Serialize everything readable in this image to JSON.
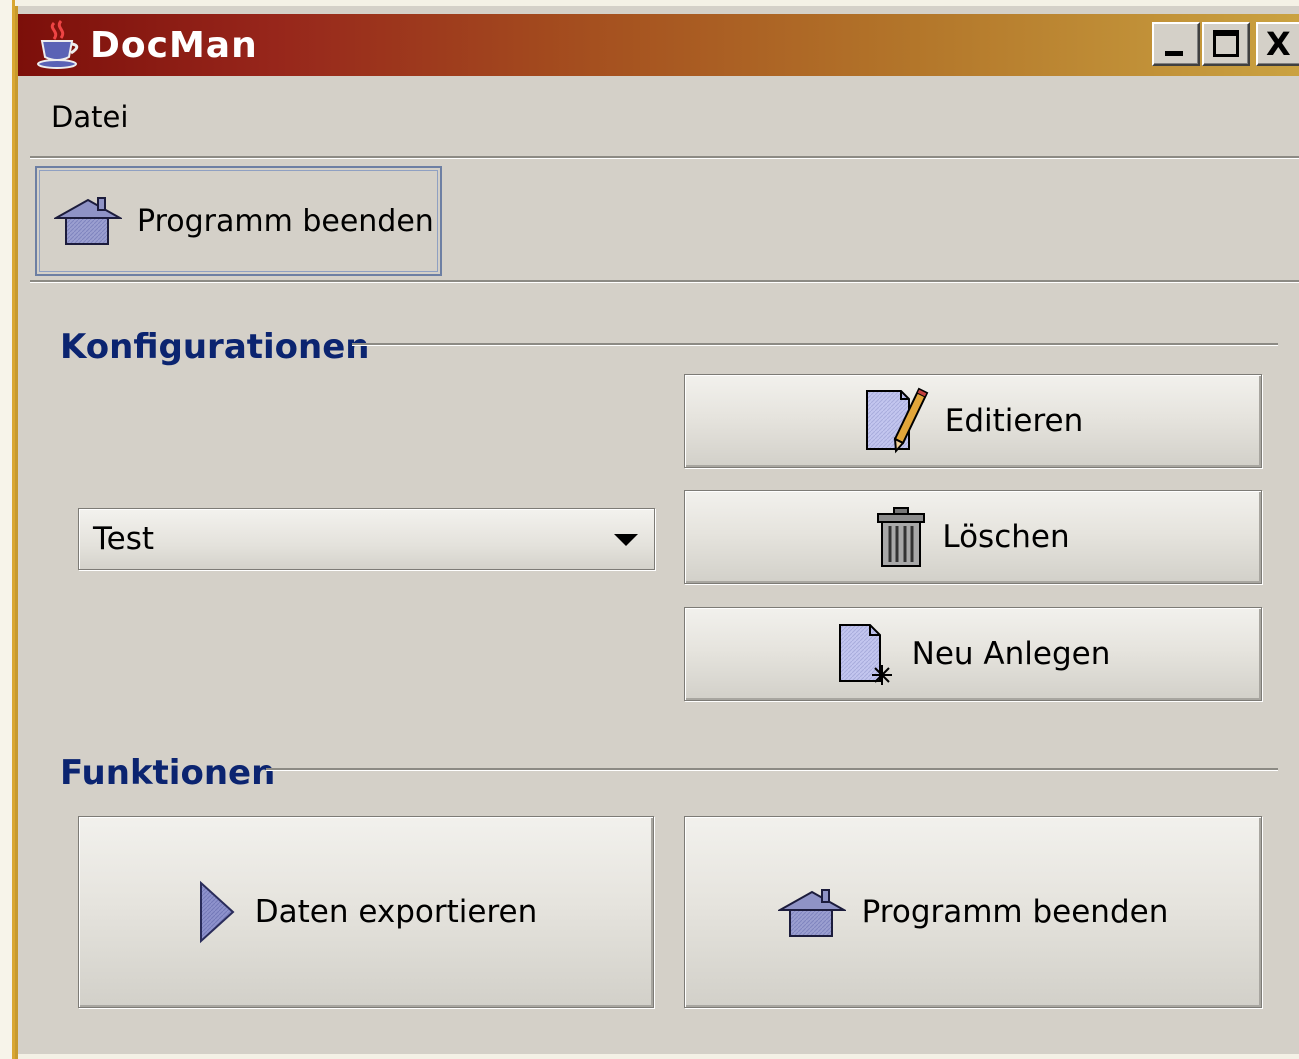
{
  "window": {
    "title": "DocMan",
    "controls": [
      "minimize-icon",
      "maximize-icon",
      "close-icon"
    ],
    "close_glyph": "X"
  },
  "menubar": {
    "items": [
      {
        "label": "Datei"
      }
    ]
  },
  "toolbar": {
    "quit_label": "Programm beenden",
    "quit_icon": "house-icon"
  },
  "configurations": {
    "title": "Konfigurationen",
    "selected": "Test",
    "buttons": {
      "edit": {
        "label": "Editieren",
        "icon": "edit-pencil-icon"
      },
      "delete": {
        "label": "Löschen",
        "icon": "trash-icon"
      },
      "new": {
        "label": "Neu Anlegen",
        "icon": "new-document-icon"
      }
    }
  },
  "functions": {
    "title": "Funktionen",
    "buttons": {
      "export": {
        "label": "Daten exportieren",
        "icon": "play-arrow-icon"
      },
      "quit": {
        "label": "Programm beenden",
        "icon": "house-icon"
      }
    }
  },
  "colors": {
    "title_gradient_start": "#7c0f0a",
    "title_gradient_end": "#caa241",
    "section_title": "#0b2470",
    "window_bg": "#d4d0c8"
  }
}
